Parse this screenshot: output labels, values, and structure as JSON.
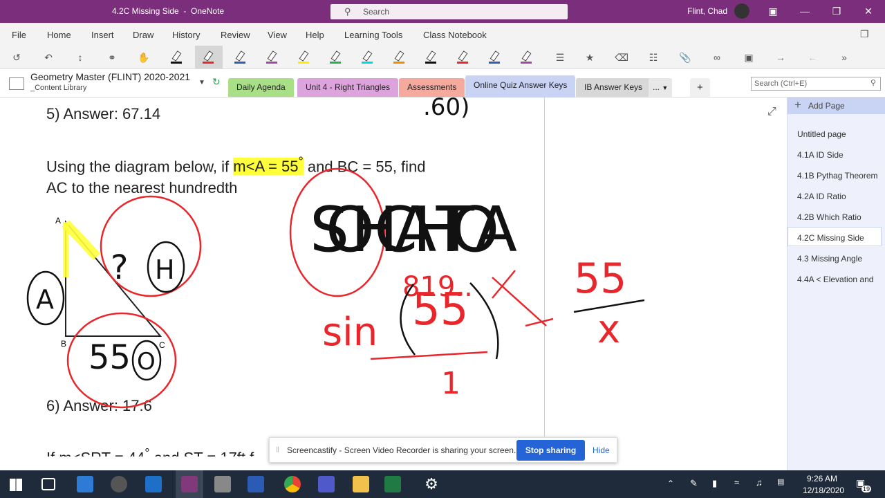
{
  "window": {
    "title": "4.2C Missing Side  -  OneNote",
    "search_placeholder": "Search",
    "user": "Flint, Chad"
  },
  "menu": [
    "File",
    "Home",
    "Insert",
    "Draw",
    "History",
    "Review",
    "View",
    "Help",
    "Learning Tools",
    "Class Notebook"
  ],
  "notebook": {
    "name": "Geometry Master (FLINT) 2020-2021",
    "section_group": "_Content Library",
    "sections": [
      "Daily Agenda",
      "Unit 4 - Right Triangles",
      "Assessments",
      "Online Quiz Answer Keys",
      "IB Answer Keys"
    ],
    "more": "...",
    "add": "+",
    "search_placeholder": "Search (Ctrl+E)"
  },
  "pages": {
    "add_label": "Add Page",
    "items": [
      "Untitled page",
      "4.1A ID Side",
      "4.1B Pythag Theorem",
      "4.2A ID Ratio",
      "4.2B Which Ratio",
      "4.2C Missing Side",
      "4.3 Missing Angle",
      "4.4A < Elevation and"
    ],
    "selected": "4.2C Missing Side"
  },
  "content": {
    "answer5": "5) Answer: 67.14",
    "question_a": "Using the diagram below, if ",
    "question_hl": "m<A = 55",
    "question_deg": "°",
    "question_b": " and BC = 55, find",
    "question_line2": "AC to the nearest hundredth",
    "answer6": "6) Answer: 17.6",
    "question3": "If m<SRT = 44",
    "question3_deg": "°",
    "question3_b": " and ST = 17ft f",
    "vertex_a": "A",
    "vertex_b": "B",
    "vertex_c": "C"
  },
  "ink": {
    "sohcahtoa": "SOHCAHTOA",
    "sin": "sin",
    "fifty_five": "55",
    "partial": "819..",
    "one": "1",
    "x": "x",
    "label_A": "A",
    "label_H": "H",
    "label_O": "O",
    "q": "?",
    "fifty_five_o": "55",
    "paren_top": ".60)"
  },
  "share": {
    "text": "Screencastify - Screen Video Recorder is sharing your screen.",
    "stop": "Stop sharing",
    "hide": "Hide"
  },
  "taskbar": {
    "time": "9:26 AM",
    "date": "12/18/2020",
    "notif": "19"
  },
  "colors": {
    "titlebar": "#7b2e7b",
    "highlight": "#ffff3b",
    "ink_red": "#e8262b",
    "ink_black": "#111111",
    "stop_btn": "#2464d6"
  }
}
